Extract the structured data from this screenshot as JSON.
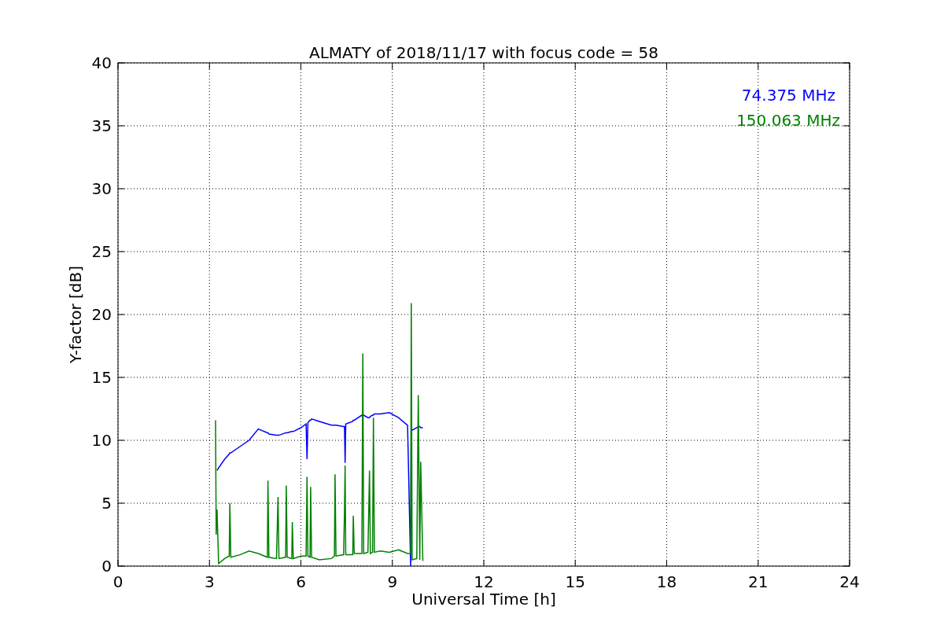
{
  "figure": {
    "chart_data": {
      "type": "line",
      "title": "ALMATY of 2018/11/17 with focus code = 58",
      "xlabel": "Universal Time [h]",
      "ylabel": "Y-factor [dB]",
      "x": [
        3.2,
        3.22,
        3.25,
        3.3,
        3.5,
        3.65,
        3.67,
        3.7,
        4.0,
        4.3,
        4.6,
        4.9,
        4.92,
        4.95,
        5.2,
        5.25,
        5.28,
        5.5,
        5.52,
        5.55,
        5.7,
        5.72,
        5.75,
        6.0,
        6.17,
        6.2,
        6.23,
        6.3,
        6.32,
        6.35,
        6.6,
        7.0,
        7.1,
        7.12,
        7.15,
        7.4,
        7.43,
        7.45,
        7.47,
        7.7,
        7.72,
        7.75,
        8.0,
        8.03,
        8.06,
        8.2,
        8.25,
        8.28,
        8.35,
        8.38,
        8.41,
        8.6,
        8.9,
        9.2,
        9.5,
        9.6,
        9.62,
        9.65,
        9.8,
        9.85,
        9.9,
        9.93,
        10.0
      ],
      "series": [
        {
          "name": "74.375 MHz",
          "color": "#0000ff",
          "values": [
            null,
            null,
            7.6,
            7.8,
            8.5,
            8.9,
            9.0,
            9.0,
            9.5,
            10.0,
            10.9,
            10.6,
            10.6,
            10.5,
            10.4,
            10.4,
            10.4,
            10.6,
            10.6,
            10.6,
            10.7,
            10.7,
            10.7,
            11.0,
            11.3,
            8.5,
            11.4,
            11.6,
            11.6,
            11.7,
            11.5,
            11.2,
            11.2,
            11.2,
            11.2,
            11.1,
            11.1,
            8.2,
            11.3,
            11.5,
            11.6,
            11.6,
            12.0,
            12.0,
            12.0,
            11.8,
            11.8,
            11.9,
            12.0,
            12.0,
            12.1,
            12.1,
            12.2,
            11.8,
            11.2,
            0.0,
            11.0,
            10.8,
            11.0,
            11.1,
            11.1,
            11.0,
            11.0
          ]
        },
        {
          "name": "150.063 MHz",
          "color": "#008000",
          "values": [
            11.6,
            2.5,
            4.5,
            0.2,
            0.6,
            0.8,
            5.0,
            0.7,
            0.9,
            1.2,
            1.0,
            0.7,
            6.8,
            0.7,
            0.6,
            5.5,
            0.6,
            0.7,
            6.4,
            0.7,
            0.6,
            3.5,
            0.6,
            0.8,
            0.8,
            7.1,
            0.8,
            0.7,
            6.3,
            0.7,
            0.5,
            0.6,
            0.8,
            7.3,
            0.8,
            0.9,
            4.3,
            8.0,
            0.9,
            0.9,
            4.0,
            1.0,
            1.0,
            16.9,
            1.0,
            1.1,
            7.6,
            1.0,
            1.1,
            11.8,
            1.1,
            1.2,
            1.1,
            1.3,
            1.0,
            1.0,
            20.9,
            0.5,
            0.6,
            13.6,
            0.5,
            8.3,
            0.4
          ]
        }
      ],
      "grid": true,
      "xlim": [
        0,
        24
      ],
      "ylim": [
        0,
        40
      ],
      "xticks": [
        0,
        3,
        6,
        9,
        12,
        15,
        18,
        21,
        24
      ],
      "yticks": [
        0,
        5,
        10,
        15,
        20,
        25,
        30,
        35,
        40
      ]
    }
  }
}
